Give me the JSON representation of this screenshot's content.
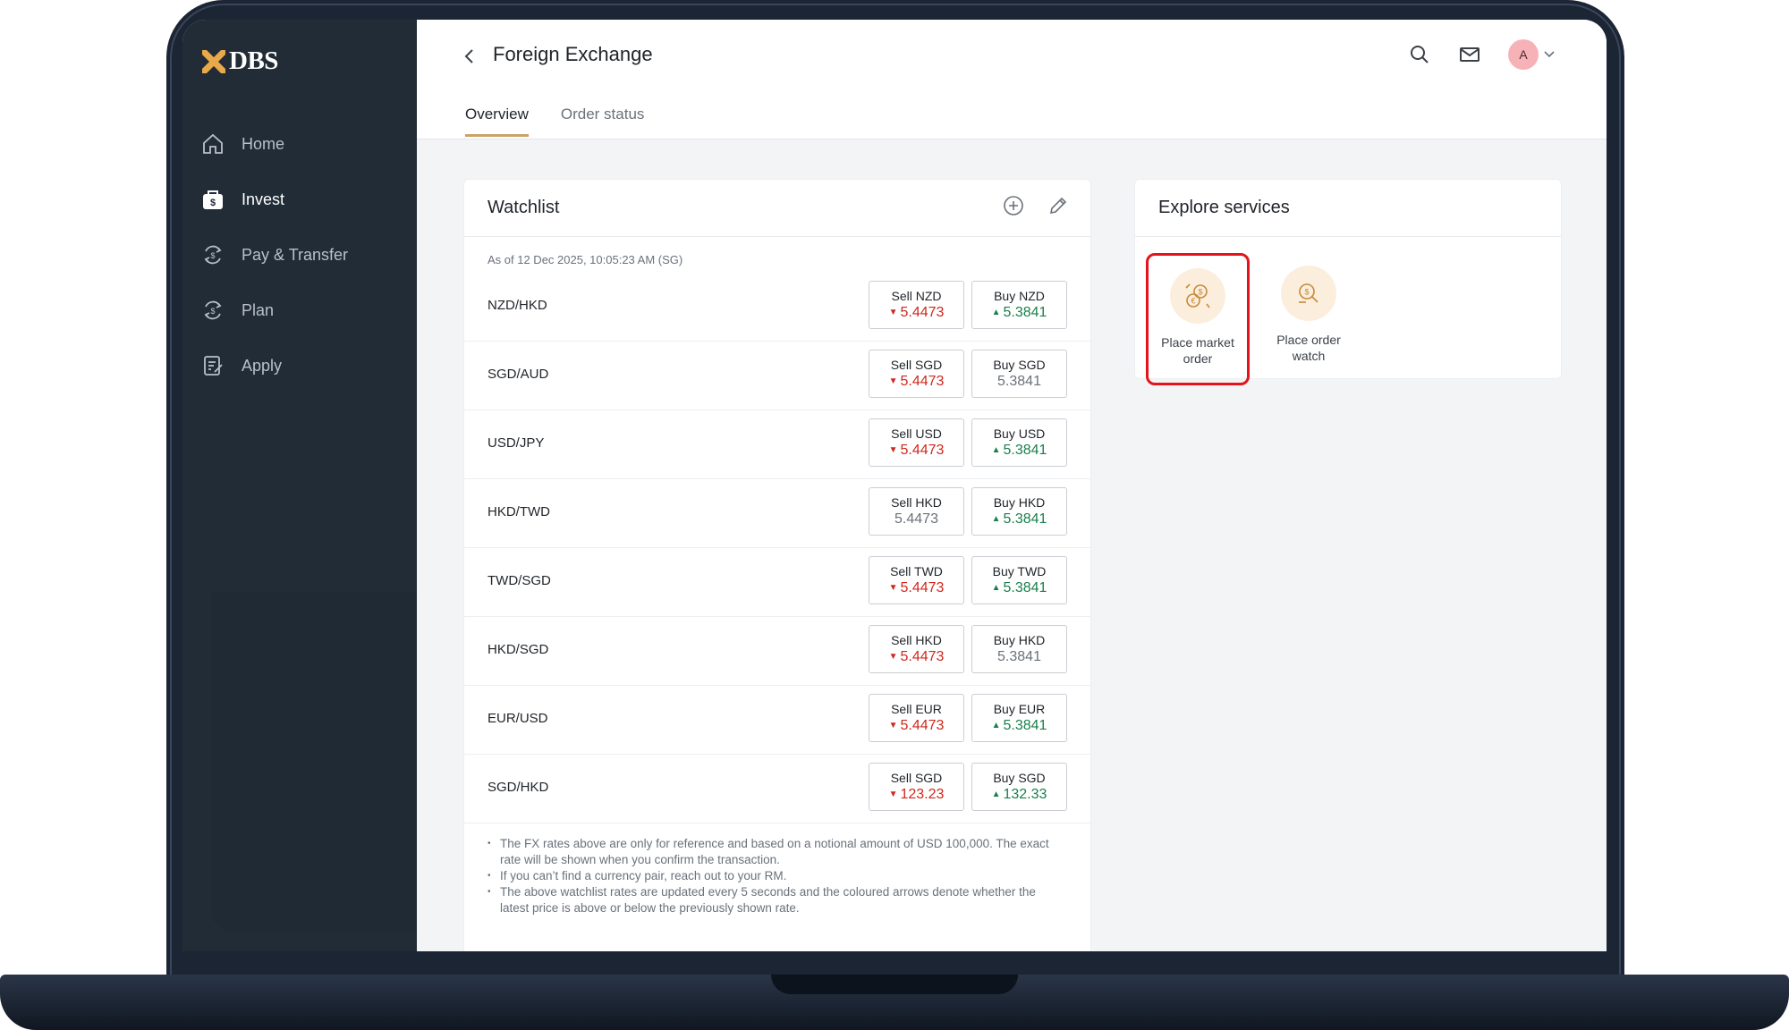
{
  "brand": {
    "logo_text": "DBS",
    "accent": "#c9a36a",
    "logo_color": "#e8a94a"
  },
  "sidebar": {
    "items": [
      {
        "label": "Home",
        "icon": "home-icon"
      },
      {
        "label": "Invest",
        "icon": "invest-bag-icon"
      },
      {
        "label": "Pay & Transfer",
        "icon": "pay-transfer-icon"
      },
      {
        "label": "Plan",
        "icon": "plan-icon"
      },
      {
        "label": "Apply",
        "icon": "apply-icon"
      }
    ],
    "active": "Invest"
  },
  "header": {
    "title": "Foreign Exchange",
    "avatar_initial": "A",
    "tabs": [
      {
        "label": "Overview",
        "active": true
      },
      {
        "label": "Order status",
        "active": false
      }
    ]
  },
  "watchlist": {
    "title": "Watchlist",
    "as_of": "As of 12 Dec 2025, 10:05:23 AM (SG)",
    "rows": [
      {
        "pair": "NZD/HKD",
        "sell_label": "Sell NZD",
        "sell_value": "5.4473",
        "sell_dir": "down",
        "buy_label": "Buy NZD",
        "buy_value": "5.3841",
        "buy_dir": "up"
      },
      {
        "pair": "SGD/AUD",
        "sell_label": "Sell SGD",
        "sell_value": "5.4473",
        "sell_dir": "down",
        "buy_label": "Buy SGD",
        "buy_value": "5.3841",
        "buy_dir": "flat"
      },
      {
        "pair": "USD/JPY",
        "sell_label": "Sell USD",
        "sell_value": "5.4473",
        "sell_dir": "down",
        "buy_label": "Buy USD",
        "buy_value": "5.3841",
        "buy_dir": "up"
      },
      {
        "pair": "HKD/TWD",
        "sell_label": "Sell HKD",
        "sell_value": "5.4473",
        "sell_dir": "flat",
        "buy_label": "Buy HKD",
        "buy_value": "5.3841",
        "buy_dir": "up"
      },
      {
        "pair": "TWD/SGD",
        "sell_label": "Sell TWD",
        "sell_value": "5.4473",
        "sell_dir": "down",
        "buy_label": "Buy TWD",
        "buy_value": "5.3841",
        "buy_dir": "up"
      },
      {
        "pair": "HKD/SGD",
        "sell_label": "Sell HKD",
        "sell_value": "5.4473",
        "sell_dir": "down",
        "buy_label": "Buy HKD",
        "buy_value": "5.3841",
        "buy_dir": "flat"
      },
      {
        "pair": "EUR/USD",
        "sell_label": "Sell EUR",
        "sell_value": "5.4473",
        "sell_dir": "down",
        "buy_label": "Buy EUR",
        "buy_value": "5.3841",
        "buy_dir": "up"
      },
      {
        "pair": "SGD/HKD",
        "sell_label": "Sell SGD",
        "sell_value": "123.23",
        "sell_dir": "down",
        "buy_label": "Buy SGD",
        "buy_value": "132.33",
        "buy_dir": "up"
      }
    ],
    "notes": [
      "The FX rates above are only for reference and based on a notional amount of USD 100,000. The exact rate will be shown when you confirm the transaction.",
      "If you can’t find a currency pair, reach out to your RM.",
      "The above watchlist rates are updated every 5 seconds and the coloured arrows denote whether the latest price is above or below the previously shown rate."
    ]
  },
  "explore": {
    "title": "Explore services",
    "services": [
      {
        "label": "Place market order",
        "icon": "currency-exchange-icon",
        "highlighted": true
      },
      {
        "label": "Place order watch",
        "icon": "order-watch-icon",
        "highlighted": false
      }
    ]
  },
  "colors": {
    "down": "#d0271d",
    "up": "#1a7f4b",
    "highlight": "#e5121b",
    "sidebar_bg": "#212c37"
  }
}
